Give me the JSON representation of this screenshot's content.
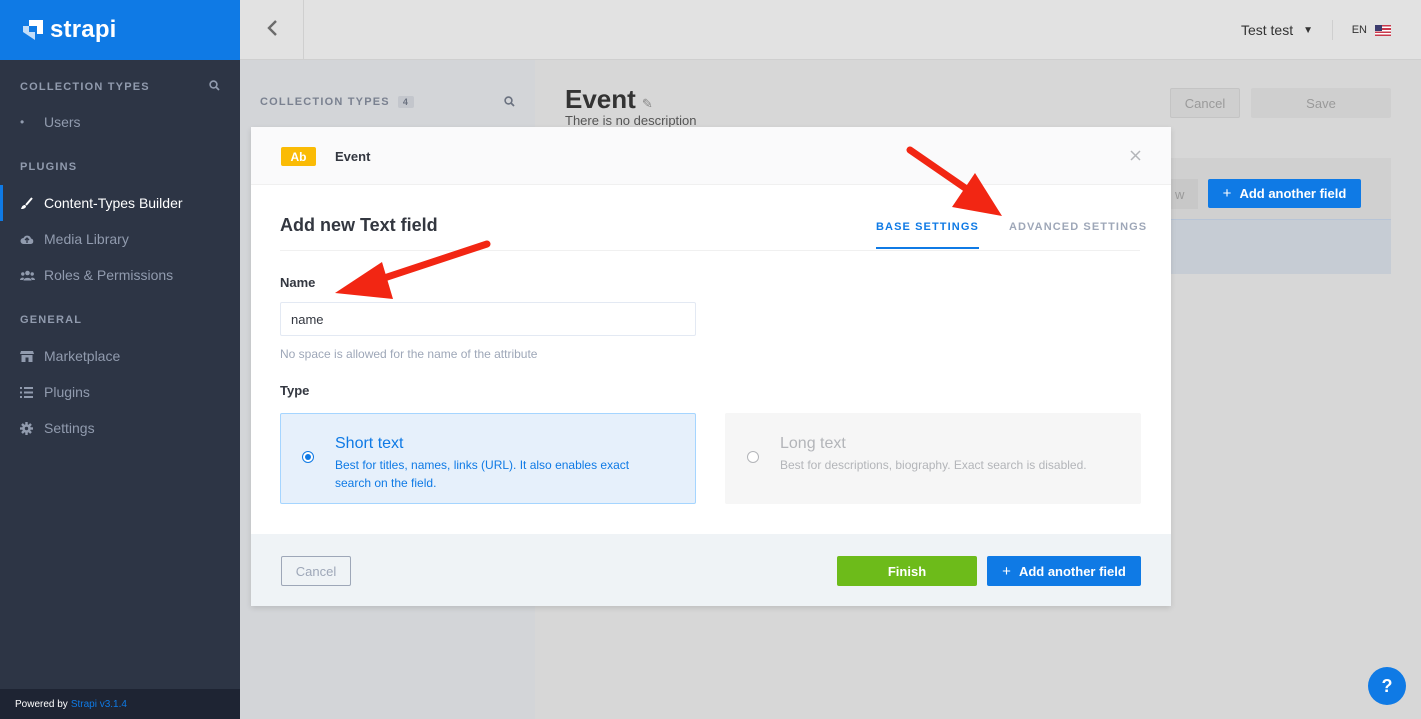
{
  "brand": {
    "name": "strapi",
    "color": "#0f7ae5"
  },
  "sidebar": {
    "sections": [
      {
        "title": "Collection Types",
        "items": [
          {
            "label": "Users",
            "icon": "bullet-icon"
          }
        ]
      },
      {
        "title": "Plugins",
        "items": [
          {
            "label": "Content-Types Builder",
            "icon": "brush-icon",
            "active": true
          },
          {
            "label": "Media Library",
            "icon": "cloud-upload-icon"
          },
          {
            "label": "Roles & Permissions",
            "icon": "users-icon"
          }
        ]
      },
      {
        "title": "General",
        "items": [
          {
            "label": "Marketplace",
            "icon": "shop-icon"
          },
          {
            "label": "Plugins",
            "icon": "list-icon"
          },
          {
            "label": "Settings",
            "icon": "gear-icon"
          }
        ]
      }
    ],
    "footer": {
      "prefix": "Powered by",
      "version": "Strapi v3.1.4"
    }
  },
  "topbar": {
    "user": "Test test",
    "language": "EN"
  },
  "collection_types": {
    "title": "Collection Types",
    "count": "4"
  },
  "content_type": {
    "name": "Event",
    "description": "There is no description",
    "cancel_label": "Cancel",
    "save_label": "Save",
    "partial_button": "w",
    "add_field_label": "Add another field"
  },
  "modal": {
    "badge": "Ab",
    "content_type": "Event",
    "title": "Add new Text field",
    "tabs": [
      {
        "label": "Base Settings",
        "active": true
      },
      {
        "label": "Advanced Settings",
        "active": false
      }
    ],
    "name_label": "Name",
    "name_value": "name",
    "name_hint": "No space is allowed for the name of the attribute",
    "type_label": "Type",
    "type_options": [
      {
        "title": "Short text",
        "description": "Best for titles, names, links (URL). It also enables exact search on the field.",
        "selected": true
      },
      {
        "title": "Long text",
        "description": "Best for descriptions, biography. Exact search is disabled.",
        "selected": false
      }
    ],
    "cancel_label": "Cancel",
    "finish_label": "Finish",
    "add_another_label": "Add another field"
  },
  "help": {
    "label": "?"
  },
  "colors": {
    "finish": "#6dbb1a",
    "accent": "#0f7ae5",
    "badge": "#fabb05",
    "annotation_arrow": "#f22613"
  }
}
